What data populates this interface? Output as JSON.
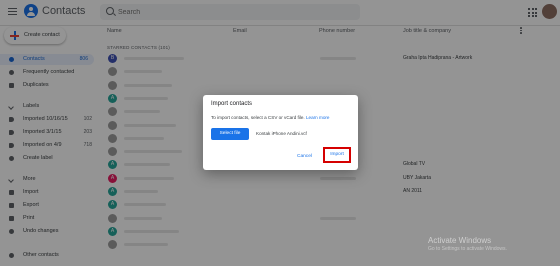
{
  "header": {
    "app_title": "Contacts",
    "search_placeholder": "Search",
    "menu_icon": "menu-icon",
    "apps_icon": "apps-grid-icon"
  },
  "sidebar": {
    "create_label": "Create contact",
    "items": [
      {
        "label": "Contacts",
        "count": "806",
        "active": true
      },
      {
        "label": "Frequently contacted",
        "count": ""
      },
      {
        "label": "Duplicates",
        "count": ""
      }
    ],
    "labels_header": "Labels",
    "labels": [
      {
        "label": "Imported 10/16/15",
        "count": "102"
      },
      {
        "label": "Imported 3/1/15",
        "count": "203"
      },
      {
        "label": "Imported on 4/9",
        "count": "718"
      }
    ],
    "create_label_item": "Create label",
    "more_header": "More",
    "more_items": [
      "Import",
      "Export",
      "Print",
      "Undo changes"
    ],
    "other_contacts": "Other contacts"
  },
  "list": {
    "columns": [
      "Name",
      "Email",
      "Phone number",
      "Job title & company"
    ],
    "section_label": "STARRED CONTACTS (101)",
    "rows": [
      {
        "initial": "B",
        "color": "#3f51b5",
        "job": "Graha Ipta Hadiprana - Artwork"
      },
      {
        "initial": "",
        "color": "#9e9e9e",
        "job": ""
      },
      {
        "initial": "",
        "color": "#9e9e9e",
        "job": ""
      },
      {
        "initial": "A",
        "color": "#26a69a",
        "job": ""
      },
      {
        "initial": "",
        "color": "#9e9e9e",
        "job": ""
      },
      {
        "initial": "",
        "color": "#9e9e9e",
        "job": ""
      },
      {
        "initial": "",
        "color": "#9e9e9e",
        "job": ""
      },
      {
        "initial": "",
        "color": "#9e9e9e",
        "job": ""
      },
      {
        "initial": "A",
        "color": "#26a69a",
        "job": "Global TV"
      },
      {
        "initial": "A",
        "color": "#e91e63",
        "job": "UBY Jakarta"
      },
      {
        "initial": "A",
        "color": "#26a69a",
        "job": "AN 2011"
      },
      {
        "initial": "A",
        "color": "#26a69a",
        "job": ""
      },
      {
        "initial": "",
        "color": "#9e9e9e",
        "job": ""
      },
      {
        "initial": "A",
        "color": "#26a69a",
        "job": ""
      },
      {
        "initial": "",
        "color": "#9e9e9e",
        "job": ""
      }
    ]
  },
  "dialog": {
    "title": "Import contacts",
    "body": "To import contacts, select a CSV or vCard file.",
    "learn_more": "Learn more",
    "select_file": "Select file",
    "file_name": "Kontak iPhone Andini.vcf",
    "cancel": "Cancel",
    "import": "Import",
    "highlight_color": "#d50000",
    "accent": "#1a73e8"
  },
  "watermark": {
    "line1": "Activate Windows",
    "line2": "Go to Settings to activate Windows."
  }
}
